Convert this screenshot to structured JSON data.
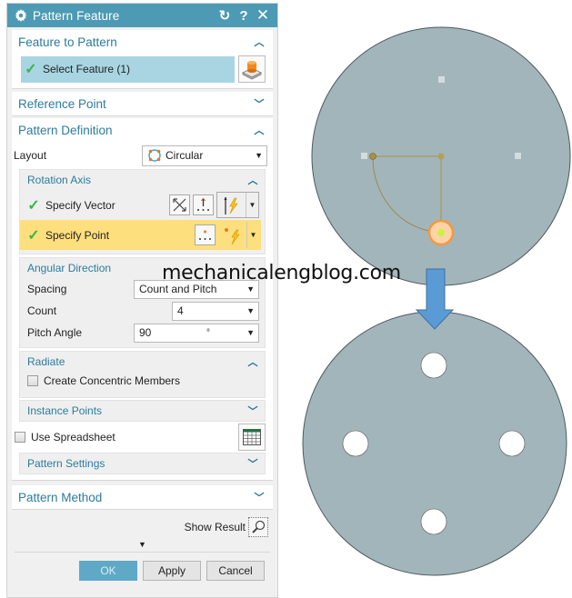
{
  "dialog": {
    "title": "Pattern Feature",
    "title_icons": [
      "gear-icon",
      "reset-icon",
      "help-icon",
      "close-icon"
    ],
    "feature_to_pattern": {
      "header": "Feature to Pattern",
      "select_label": "Select Feature (1)",
      "expanded": true
    },
    "reference_point": {
      "header": "Reference Point",
      "expanded": false
    },
    "pattern_definition": {
      "header": "Pattern Definition",
      "expanded": true,
      "layout_label": "Layout",
      "layout_value": "Circular",
      "rotation_axis": {
        "header": "Rotation Axis",
        "specify_vector_label": "Specify Vector",
        "specify_point_label": "Specify Point"
      },
      "angular_direction": {
        "header": "Angular Direction",
        "spacing_label": "Spacing",
        "spacing_value": "Count and Pitch",
        "count_label": "Count",
        "count_value": "4",
        "pitch_angle_label": "Pitch Angle",
        "pitch_angle_value": "90",
        "pitch_angle_unit": "°"
      },
      "radiate": {
        "header": "Radiate",
        "create_concentric_label": "Create Concentric Members",
        "create_concentric_checked": false
      },
      "instance_points": {
        "header": "Instance Points"
      },
      "use_spreadsheet_label": "Use Spreadsheet",
      "use_spreadsheet_checked": false,
      "pattern_settings": {
        "header": "Pattern Settings"
      }
    },
    "pattern_method": {
      "header": "Pattern Method",
      "expanded": false
    },
    "show_result_label": "Show Result",
    "buttons": {
      "ok": "OK",
      "apply": "Apply",
      "cancel": "Cancel"
    }
  },
  "watermark": "mechanicalengblog.com",
  "illustration": {
    "before": {
      "description": "disc with single hole selected and circular pattern preview handles"
    },
    "after": {
      "description": "disc with 4 holes patterned at 90° spacing",
      "hole_count": 4
    }
  },
  "colors": {
    "titlebar": "#4d9ab4",
    "header_text": "#2b7c9e",
    "selection_bar": "#a9d5e3",
    "active_row": "#fedf7e",
    "ok_button": "#5fa9c6",
    "disc_fill": "#a2b5bb",
    "arrow": "#5b9bd5"
  }
}
